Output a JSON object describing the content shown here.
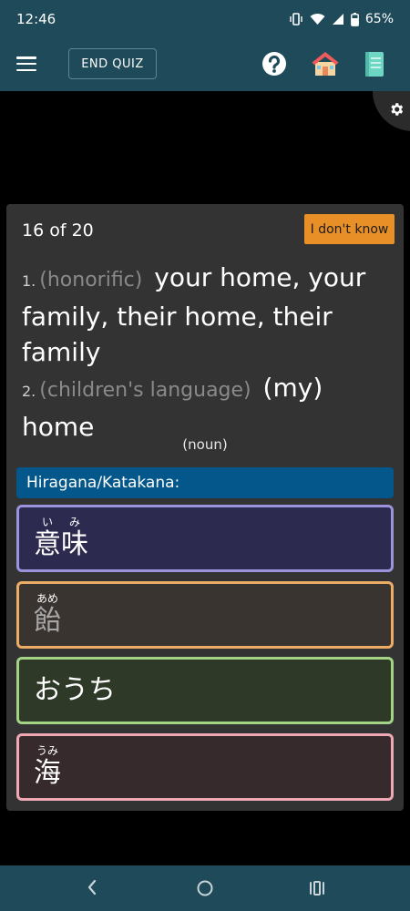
{
  "status": {
    "time": "12:46",
    "battery": "65%"
  },
  "toolbar": {
    "end_quiz_label": "END QUIZ",
    "icons": [
      "menu-icon",
      "help-icon",
      "home-icon",
      "notebook-icon"
    ]
  },
  "settings": {
    "icon": "gear-icon"
  },
  "quiz": {
    "counter": "16 of 20",
    "dont_know_label": "I don't know",
    "definitions": [
      {
        "num": "1.",
        "note": "(honorific)",
        "text": "your home, your family, their home, their family"
      },
      {
        "num": "2.",
        "note": "(children's language)",
        "text": "(my) home"
      }
    ],
    "part_of_speech": "(noun)",
    "prompt": "Hiragana/Katakana:",
    "options": [
      {
        "chars": [
          {
            "kanji": "意",
            "ruby": "い"
          },
          {
            "kanji": "味",
            "ruby": "み"
          }
        ]
      },
      {
        "chars": [
          {
            "kanji": "飴",
            "ruby": "あめ"
          }
        ]
      },
      {
        "text": "おうち"
      },
      {
        "chars": [
          {
            "kanji": "海",
            "ruby": "うみ"
          }
        ]
      }
    ]
  },
  "colors": {
    "bar": "#1f4a59",
    "accent_orange": "#e89027",
    "prompt_blue": "#03578a"
  },
  "nav": {
    "icons": [
      "back-icon",
      "home-circle-icon",
      "recents-icon"
    ]
  }
}
